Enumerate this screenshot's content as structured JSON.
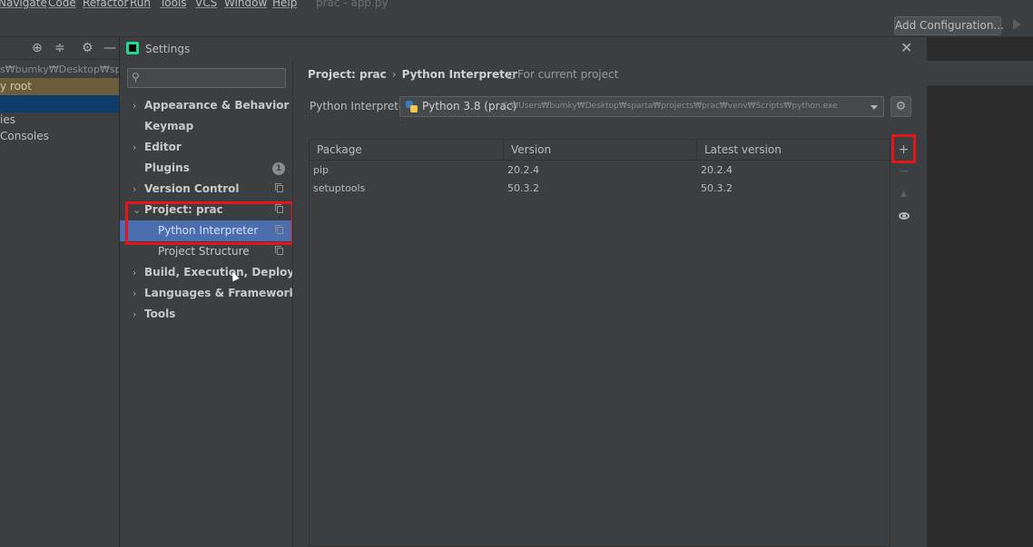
{
  "menubar": {
    "items": [
      "Navigate",
      "Code",
      "Refactor",
      "Run",
      "Tools",
      "VCS",
      "Window",
      "Help"
    ],
    "window_title": "prac - app.py"
  },
  "toolbar": {
    "add_configuration": "Add Configuration..."
  },
  "project_panel": {
    "path_fragment": "s₩bumky₩Desktop₩sparta",
    "root_label": "y root",
    "libs_label": "ies",
    "consoles_label": "Consoles"
  },
  "dialog": {
    "title": "Settings",
    "search_placeholder": "",
    "nav": [
      {
        "label": "Appearance & Behavior",
        "chevron": "›"
      },
      {
        "label": "Keymap",
        "chevron": ""
      },
      {
        "label": "Editor",
        "chevron": "›"
      },
      {
        "label": "Plugins",
        "chevron": "",
        "badge": "1"
      },
      {
        "label": "Version Control",
        "chevron": "›"
      },
      {
        "label": "Project: prac",
        "chevron": "⌄"
      },
      {
        "label": "Python Interpreter",
        "chevron": ""
      },
      {
        "label": "Project Structure",
        "chevron": ""
      },
      {
        "label": "Build, Execution, Deployment",
        "chevron": "›"
      },
      {
        "label": "Languages & Frameworks",
        "chevron": "›"
      },
      {
        "label": "Tools",
        "chevron": "›"
      }
    ],
    "breadcrumb": {
      "parent": "Project: prac",
      "separator": "›",
      "current": "Python Interpreter"
    },
    "for_current_project": "For current project",
    "interpreter_label": "Python Interpreter:",
    "interpreter_name": "Python 3.8 (prac)",
    "interpreter_path": "C:₩Users₩bumky₩Desktop₩sparta₩projects₩prac₩venv₩Scripts₩python.exe",
    "table": {
      "headers": [
        "Package",
        "Version",
        "Latest version"
      ],
      "rows": [
        [
          "pip",
          "20.2.4",
          "20.2.4"
        ],
        [
          "setuptools",
          "50.3.2",
          "50.3.2"
        ]
      ]
    },
    "tools": {
      "add": "+",
      "remove": "−",
      "upgrade": "▲"
    }
  },
  "colors": {
    "selection": "#4b6eaf",
    "highlight": "#e2161b",
    "background": "#3c3f41"
  }
}
